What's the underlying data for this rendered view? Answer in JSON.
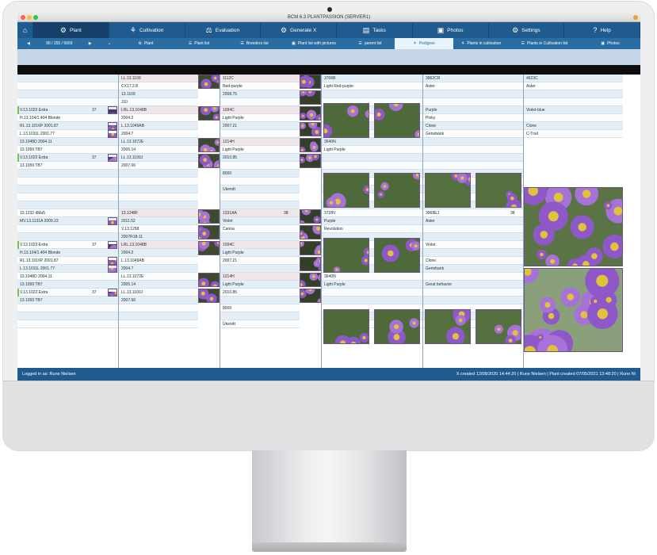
{
  "window": {
    "title": "BCM 6.3 PLANTPASSION (SERVER1)"
  },
  "nav": [
    {
      "label": "Plant",
      "icon": "gear-icon"
    },
    {
      "label": "Cultivation",
      "icon": "pot-icon"
    },
    {
      "label": "Evaluation",
      "icon": "scale-icon"
    },
    {
      "label": "Generate X",
      "icon": "gears-icon"
    },
    {
      "label": "Tasks",
      "icon": "clipboard-icon"
    },
    {
      "label": "Photos",
      "icon": "photo-icon"
    },
    {
      "label": "Settings",
      "icon": "gear-icon"
    },
    {
      "label": "Help",
      "icon": "question-icon"
    }
  ],
  "subnav": {
    "record": "90 / 255 / 5669",
    "tabs": [
      "Plant",
      "Plant list",
      "Breeders list",
      "Plant list with pictures",
      "parent list",
      "Pedigree",
      "Plants in cultivation",
      "Plants in Cultivation list",
      "Photos"
    ],
    "active": "Pedigree"
  },
  "pedigree": {
    "col1": [
      "",
      "",
      "",
      "",
      "V.13.1022 Extra",
      "H.13.104/1.404 Blonde",
      "RL.13.1016P 2001.87",
      "L.13.1011L 2001.77",
      "13.1048D 2004.11",
      "13.1059 TB7",
      "V.13.1022 Extra",
      "13.1059 TB7",
      "",
      "",
      "",
      "",
      "",
      "13.1232 dMa5",
      "MV.13.1131A 2009.23",
      "",
      "",
      "V.13.1022 Extra",
      "H.13.104/1.404 Blonde",
      "RL.13.1016P 2001.87",
      "L.13.1011L 2001.77",
      "13.1048D 2004.11",
      "13.1059 TB7",
      "V.13.1022 Extra",
      "13.1059 TB7",
      "",
      "",
      ""
    ],
    "col1_num": "37",
    "col2": [
      "LL.13.1109",
      "CX17.2.8",
      "13.1109",
      "J10",
      "LRL.13.1048B",
      "2004.2",
      "L.13.1049AB",
      "2004.7",
      "LL.13.1072E",
      "2005.14",
      "LL.13.1100J",
      "2007.66",
      "",
      "",
      "",
      "",
      "",
      "13.1248F",
      "2011.52",
      "V.13.1258",
      "2007R18-11",
      "LRL.13.1048B",
      "2004.2",
      "L.13.1049AB",
      "2004.7",
      "LL.13.1072E",
      "2005.14",
      "LL.13.1100J",
      "2007.66",
      "",
      "",
      ""
    ],
    "col3": [
      "1112C",
      "Red-purple",
      "2008.75",
      "",
      "1094C",
      "Light Purple",
      "2007.21",
      "",
      "1214H",
      "Light Purple",
      "2010.85",
      "",
      "8000",
      "",
      "Ukendt",
      "",
      "",
      "1331AA",
      "Violet",
      "Carina",
      "",
      "1094C",
      "Light Purple",
      "2007.21",
      "",
      "1214H",
      "Light Purple",
      "2010.85",
      "",
      "8000",
      "",
      "Ukendt"
    ],
    "col3_num": "38",
    "col4": [
      "3706B",
      "Light Red-purple",
      "",
      "",
      "",
      "",
      "",
      "",
      "3640N",
      "Light Purple",
      "",
      "",
      "",
      "",
      "",
      "",
      "",
      "3728V",
      "Purple",
      "Revolution",
      "",
      "",
      "",
      "",
      "",
      "3640N",
      "Light Purple",
      "",
      "",
      "",
      "",
      ""
    ],
    "col5": [
      "3962CR",
      "Aster",
      "",
      "",
      "Purple",
      "Pinky",
      "Clone",
      "Genebank",
      "",
      "",
      "",
      "",
      "",
      "",
      "",
      "",
      "",
      "3968EJ",
      "Aster",
      "",
      "",
      "Violet",
      "",
      "Clone",
      "Genebank",
      "",
      "Great behavior",
      "",
      "",
      "",
      "",
      ""
    ],
    "col5_num": "38",
    "col6": [
      "4623C",
      "Aster",
      "",
      "",
      "Violet-blue",
      "",
      "Clone",
      "C-Trail"
    ]
  },
  "status": {
    "left": "Logged in as: Rune Nielsen",
    "right": "X created 12/08/2020 14:44:20 | Rune Nielsen | Plant created 07/05/2021 13:48:20 | Rune Ni"
  }
}
